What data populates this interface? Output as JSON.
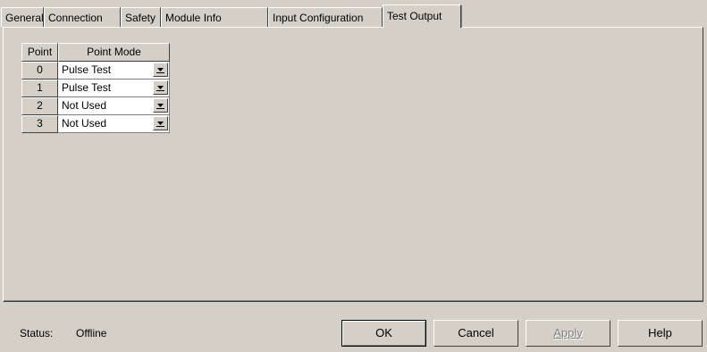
{
  "tabs": [
    {
      "label": "General",
      "active": false
    },
    {
      "label": "Connection",
      "active": false
    },
    {
      "label": "Safety",
      "active": false
    },
    {
      "label": "Module Info",
      "active": false
    },
    {
      "label": "Input Configuration",
      "active": false
    },
    {
      "label": "Test Output",
      "active": true
    }
  ],
  "grid": {
    "headers": {
      "point": "Point",
      "mode": "Point Mode"
    },
    "rows": [
      {
        "point": "0",
        "mode": "Pulse Test"
      },
      {
        "point": "1",
        "mode": "Pulse Test"
      },
      {
        "point": "2",
        "mode": "Not Used"
      },
      {
        "point": "3",
        "mode": "Not Used"
      }
    ]
  },
  "status": {
    "label": "Status:",
    "value": "Offline"
  },
  "buttons": {
    "ok": "OK",
    "cancel": "Cancel",
    "apply": "Apply",
    "help": "Help"
  },
  "icons": {
    "dropdown": "chevron-down-icon"
  },
  "colors": {
    "background": "#d4d0c8",
    "field": "#ffffff",
    "disabled_text": "#808080"
  }
}
